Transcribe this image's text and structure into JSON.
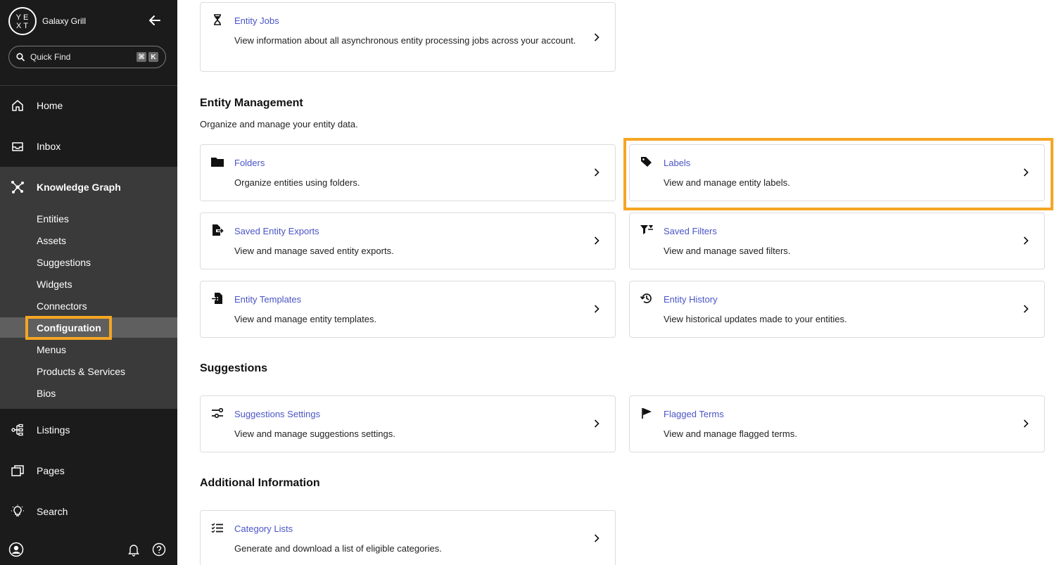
{
  "sidebar": {
    "brand": {
      "logo_top": "YE",
      "logo_bottom": "XT",
      "name": "Galaxy Grill"
    },
    "quick_find": {
      "label": "Quick Find",
      "shortcut_cmd": "⌘",
      "shortcut_key": "K"
    },
    "nav": [
      {
        "label": "Home",
        "icon": "home-icon"
      },
      {
        "label": "Inbox",
        "icon": "inbox-icon"
      },
      {
        "label": "Knowledge Graph",
        "icon": "knowledge-graph-icon"
      },
      {
        "label": "Listings",
        "icon": "listings-icon"
      },
      {
        "label": "Pages",
        "icon": "pages-icon"
      },
      {
        "label": "Search",
        "icon": "search-bulb-icon"
      }
    ],
    "kg_sub_items": [
      {
        "label": "Entities"
      },
      {
        "label": "Assets"
      },
      {
        "label": "Suggestions"
      },
      {
        "label": "Widgets"
      },
      {
        "label": "Connectors"
      },
      {
        "label": "Configuration",
        "active": true
      },
      {
        "label": "Menus"
      },
      {
        "label": "Products & Services"
      },
      {
        "label": "Bios"
      }
    ]
  },
  "main": {
    "top_card": {
      "title": "Entity Jobs",
      "desc": "View information about all asynchronous entity processing jobs across your account.",
      "icon": "hourglass-icon"
    },
    "entity_management": {
      "title": "Entity Management",
      "desc": "Organize and manage your entity data.",
      "cards": [
        {
          "title": "Folders",
          "desc": "Organize entities using folders.",
          "icon": "folder-icon"
        },
        {
          "title": "Labels",
          "desc": "View and manage entity labels.",
          "icon": "tag-icon"
        },
        {
          "title": "Saved Entity Exports",
          "desc": "View and manage saved entity exports.",
          "icon": "export-icon"
        },
        {
          "title": "Saved Filters",
          "desc": "View and manage saved filters.",
          "icon": "filter-icon"
        },
        {
          "title": "Entity Templates",
          "desc": "View and manage entity templates.",
          "icon": "template-icon"
        },
        {
          "title": "Entity History",
          "desc": "View historical updates made to your entities.",
          "icon": "history-icon"
        }
      ]
    },
    "suggestions": {
      "title": "Suggestions",
      "cards": [
        {
          "title": "Suggestions Settings",
          "desc": "View and manage suggestions settings.",
          "icon": "settings-sliders-icon"
        },
        {
          "title": "Flagged Terms",
          "desc": "View and manage flagged terms.",
          "icon": "flag-icon"
        }
      ]
    },
    "additional": {
      "title": "Additional Information",
      "cards": [
        {
          "title": "Category Lists",
          "desc": "Generate and download a list of eligible categories.",
          "icon": "checklist-icon"
        }
      ]
    }
  },
  "colors": {
    "sidebar_bg": "#1b1b1b",
    "kg_panel_bg": "#3a3a3a",
    "active_item_bg": "#5f5f5f",
    "highlight": "#f5a623",
    "link": "#4a55c5"
  }
}
